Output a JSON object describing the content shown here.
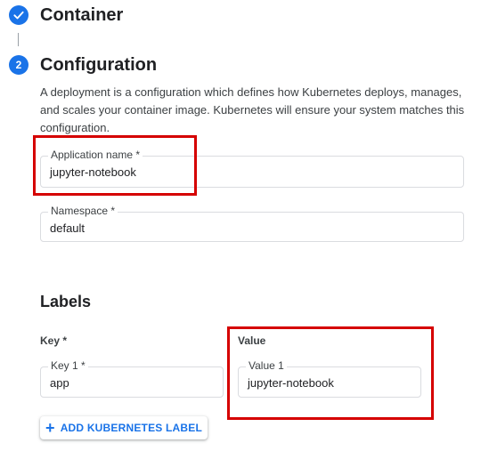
{
  "steps": [
    {
      "number": "",
      "title": "Container",
      "status": "completed",
      "icon": "check-icon"
    },
    {
      "number": "2",
      "title": "Configuration",
      "status": "active"
    }
  ],
  "configuration": {
    "description": "A deployment is a configuration which defines how Kubernetes deploys, manages, and scales your container image. Kubernetes will ensure your system matches this configuration.",
    "application_name": {
      "label": "Application name *",
      "value": "jupyter-notebook"
    },
    "namespace": {
      "label": "Namespace *",
      "value": "default"
    }
  },
  "labels": {
    "title": "Labels",
    "key_header": "Key *",
    "value_header": "Value",
    "rows": [
      {
        "key_label": "Key 1 *",
        "key_value": "app",
        "value_label": "Value 1",
        "value_value": "jupyter-notebook"
      }
    ],
    "add_button": "ADD KUBERNETES LABEL"
  },
  "colors": {
    "accent": "#1a73e8",
    "highlight": "#d50000"
  }
}
